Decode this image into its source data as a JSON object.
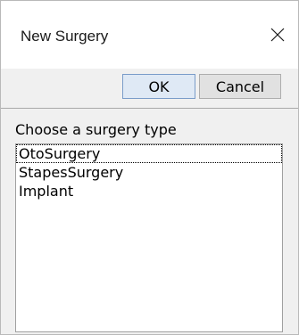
{
  "window": {
    "title": "New Surgery",
    "close_icon": "close-icon"
  },
  "buttons": {
    "ok_label": "OK",
    "cancel_label": "Cancel"
  },
  "content": {
    "prompt": "Choose a surgery type",
    "items": [
      {
        "label": "OtoSurgery",
        "focused": true
      },
      {
        "label": "StapesSurgery",
        "focused": false
      },
      {
        "label": "Implant",
        "focused": false
      }
    ]
  }
}
